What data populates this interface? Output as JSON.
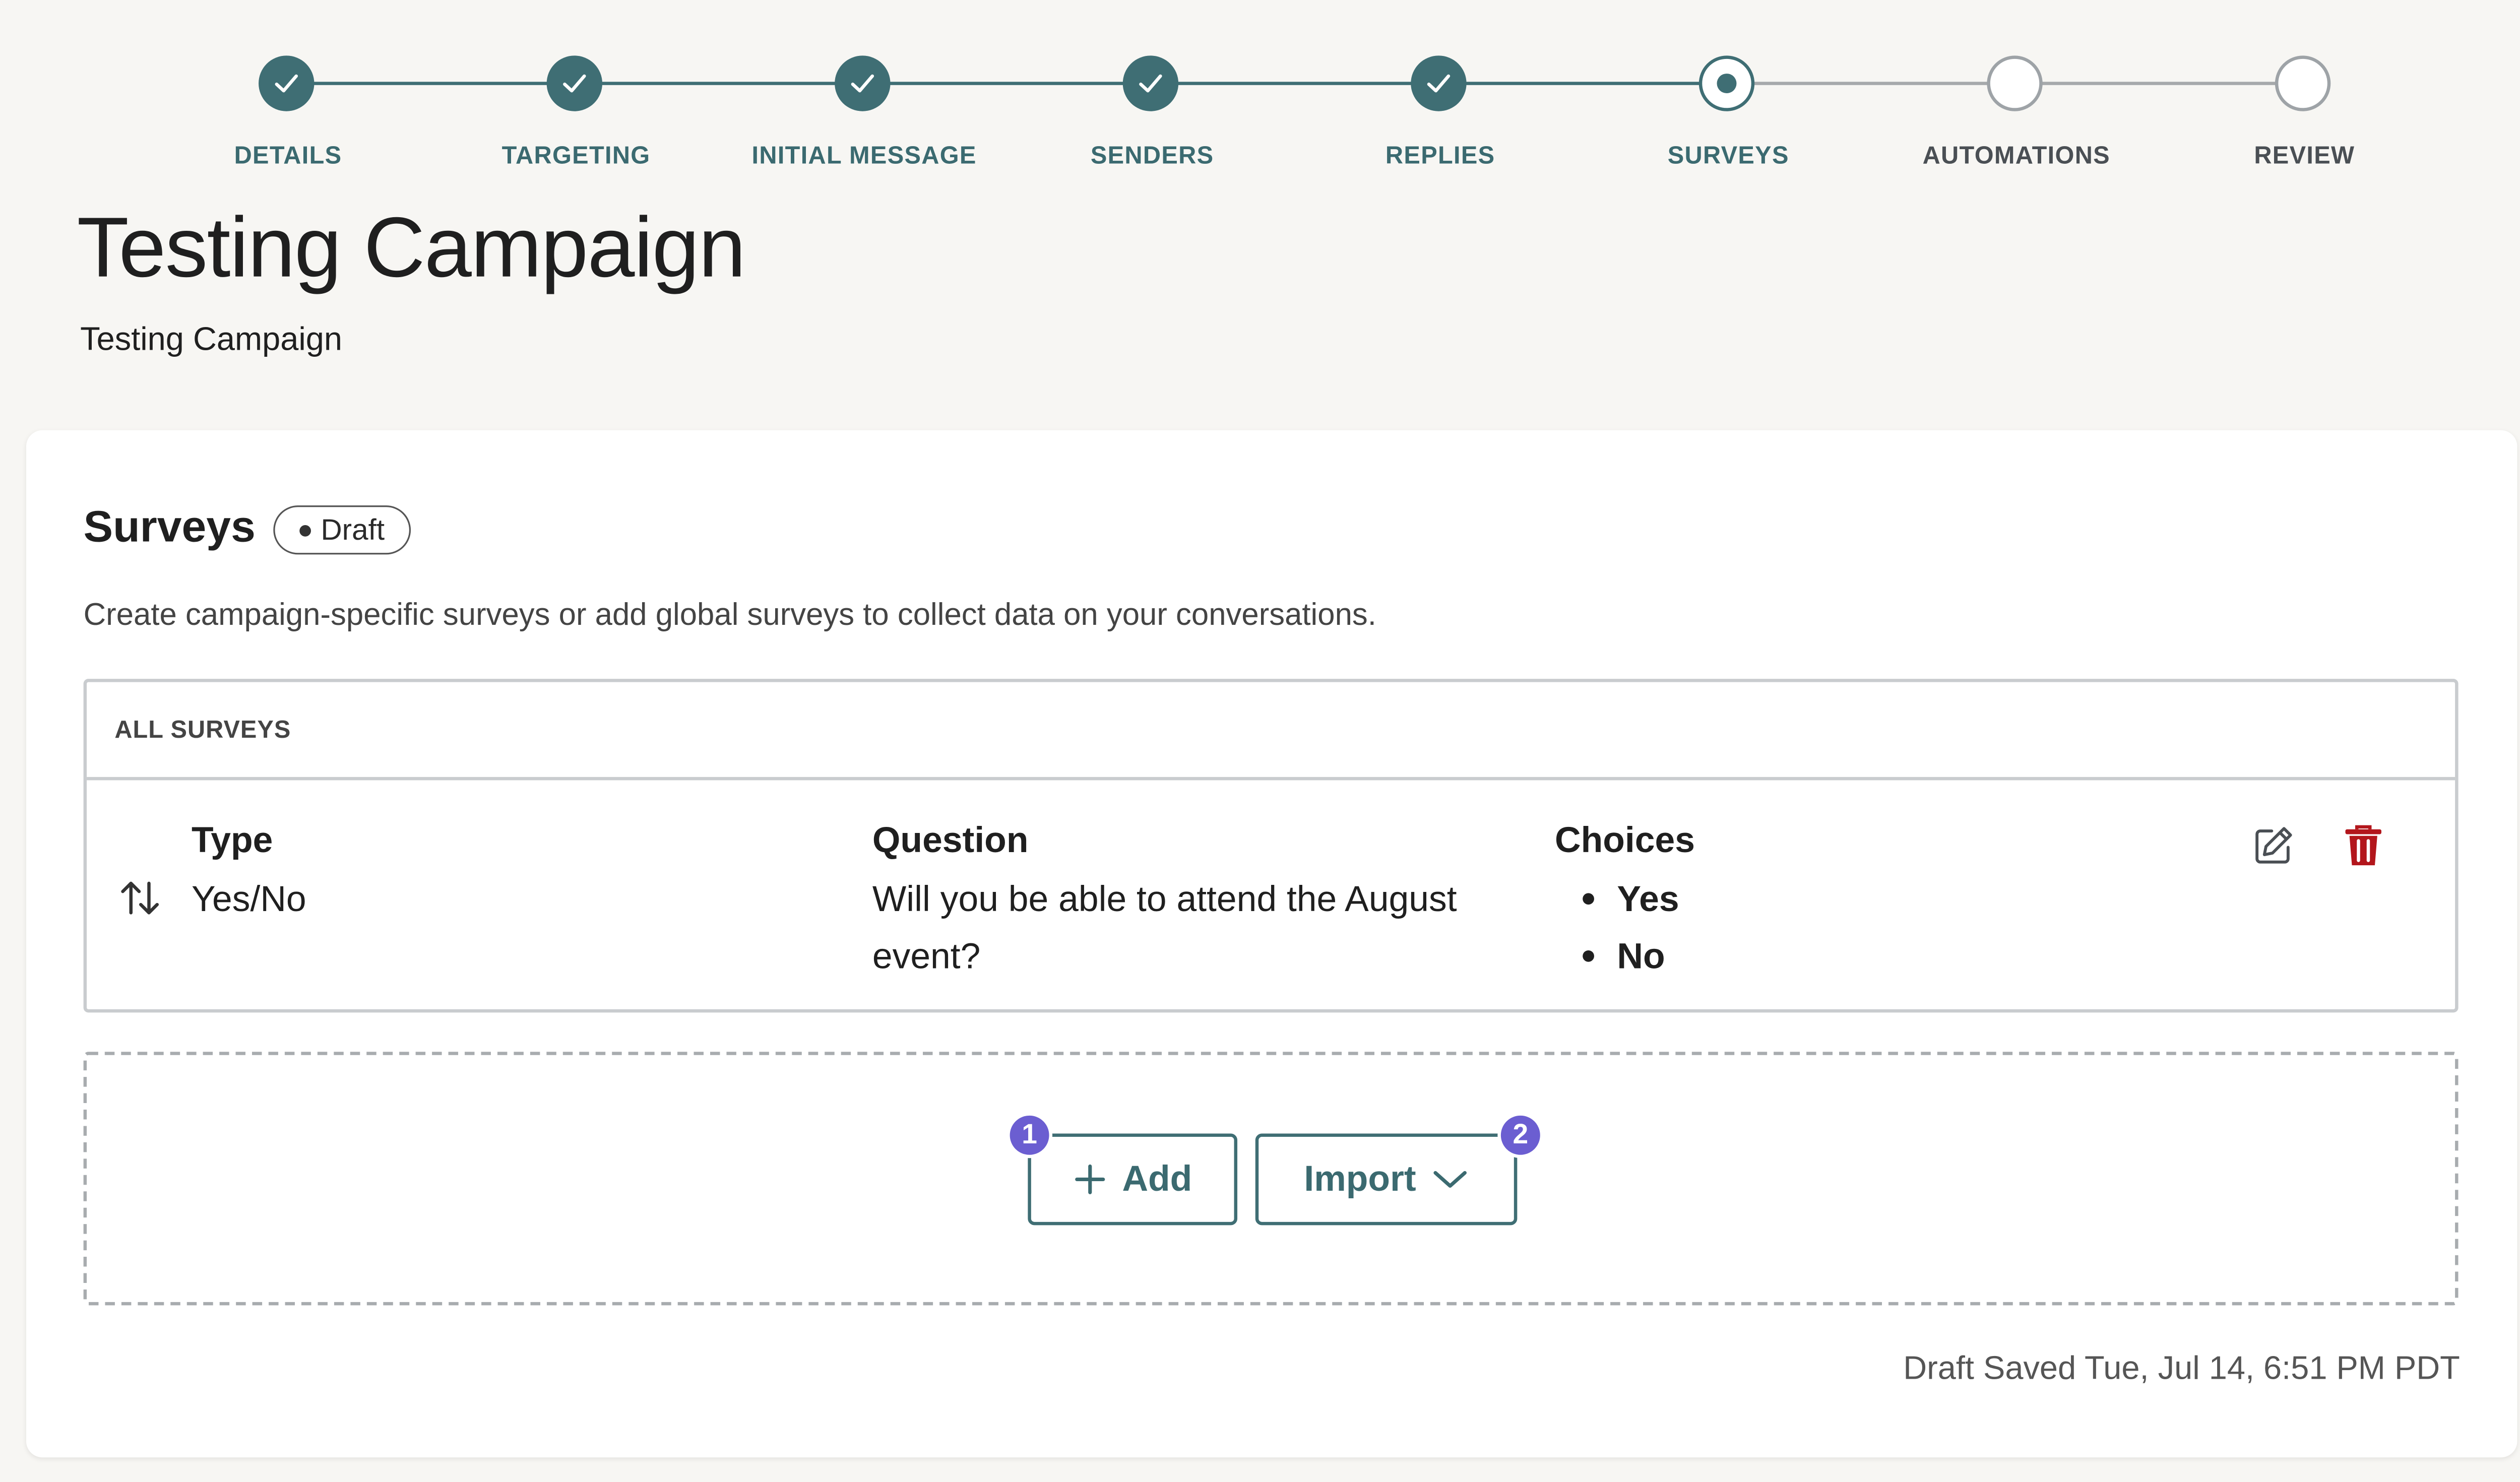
{
  "stepper": {
    "steps": [
      {
        "label": "DETAILS",
        "state": "done"
      },
      {
        "label": "TARGETING",
        "state": "done"
      },
      {
        "label": "INITIAL MESSAGE",
        "state": "done"
      },
      {
        "label": "SENDERS",
        "state": "done"
      },
      {
        "label": "REPLIES",
        "state": "done"
      },
      {
        "label": "SURVEYS",
        "state": "current"
      },
      {
        "label": "AUTOMATIONS",
        "state": "todo"
      },
      {
        "label": "REVIEW",
        "state": "todo"
      }
    ]
  },
  "page": {
    "title": "Testing Campaign",
    "subtitle": "Testing Campaign"
  },
  "surveys": {
    "title": "Surveys",
    "badge": "Draft",
    "description": "Create campaign-specific surveys or add global surveys to collect data on your conversations.",
    "table_header": "ALL SURVEYS",
    "columns": {
      "type": "Type",
      "question": "Question",
      "choices": "Choices"
    },
    "rows": [
      {
        "type": "Yes/No",
        "question_line1": "Will you be able to attend the August",
        "question_line2": "event?",
        "choices": [
          "Yes",
          "No"
        ]
      }
    ],
    "actions": {
      "add_label": "Add",
      "import_label": "Import"
    },
    "markers": {
      "one": "1",
      "two": "2"
    },
    "saved_status": "Draft Saved Tue, Jul 14, 6:51 PM PDT"
  },
  "colors": {
    "accent": "#3f6e74",
    "delete": "#b3161c",
    "marker": "#6b5ed1",
    "background": "#f7f6f3"
  },
  "icons": {
    "done_step": "check-icon",
    "sort": "sort-arrows-icon",
    "edit": "pencil-edit-icon",
    "delete": "trash-icon",
    "add": "plus-icon",
    "import": "chevron-down-icon"
  }
}
